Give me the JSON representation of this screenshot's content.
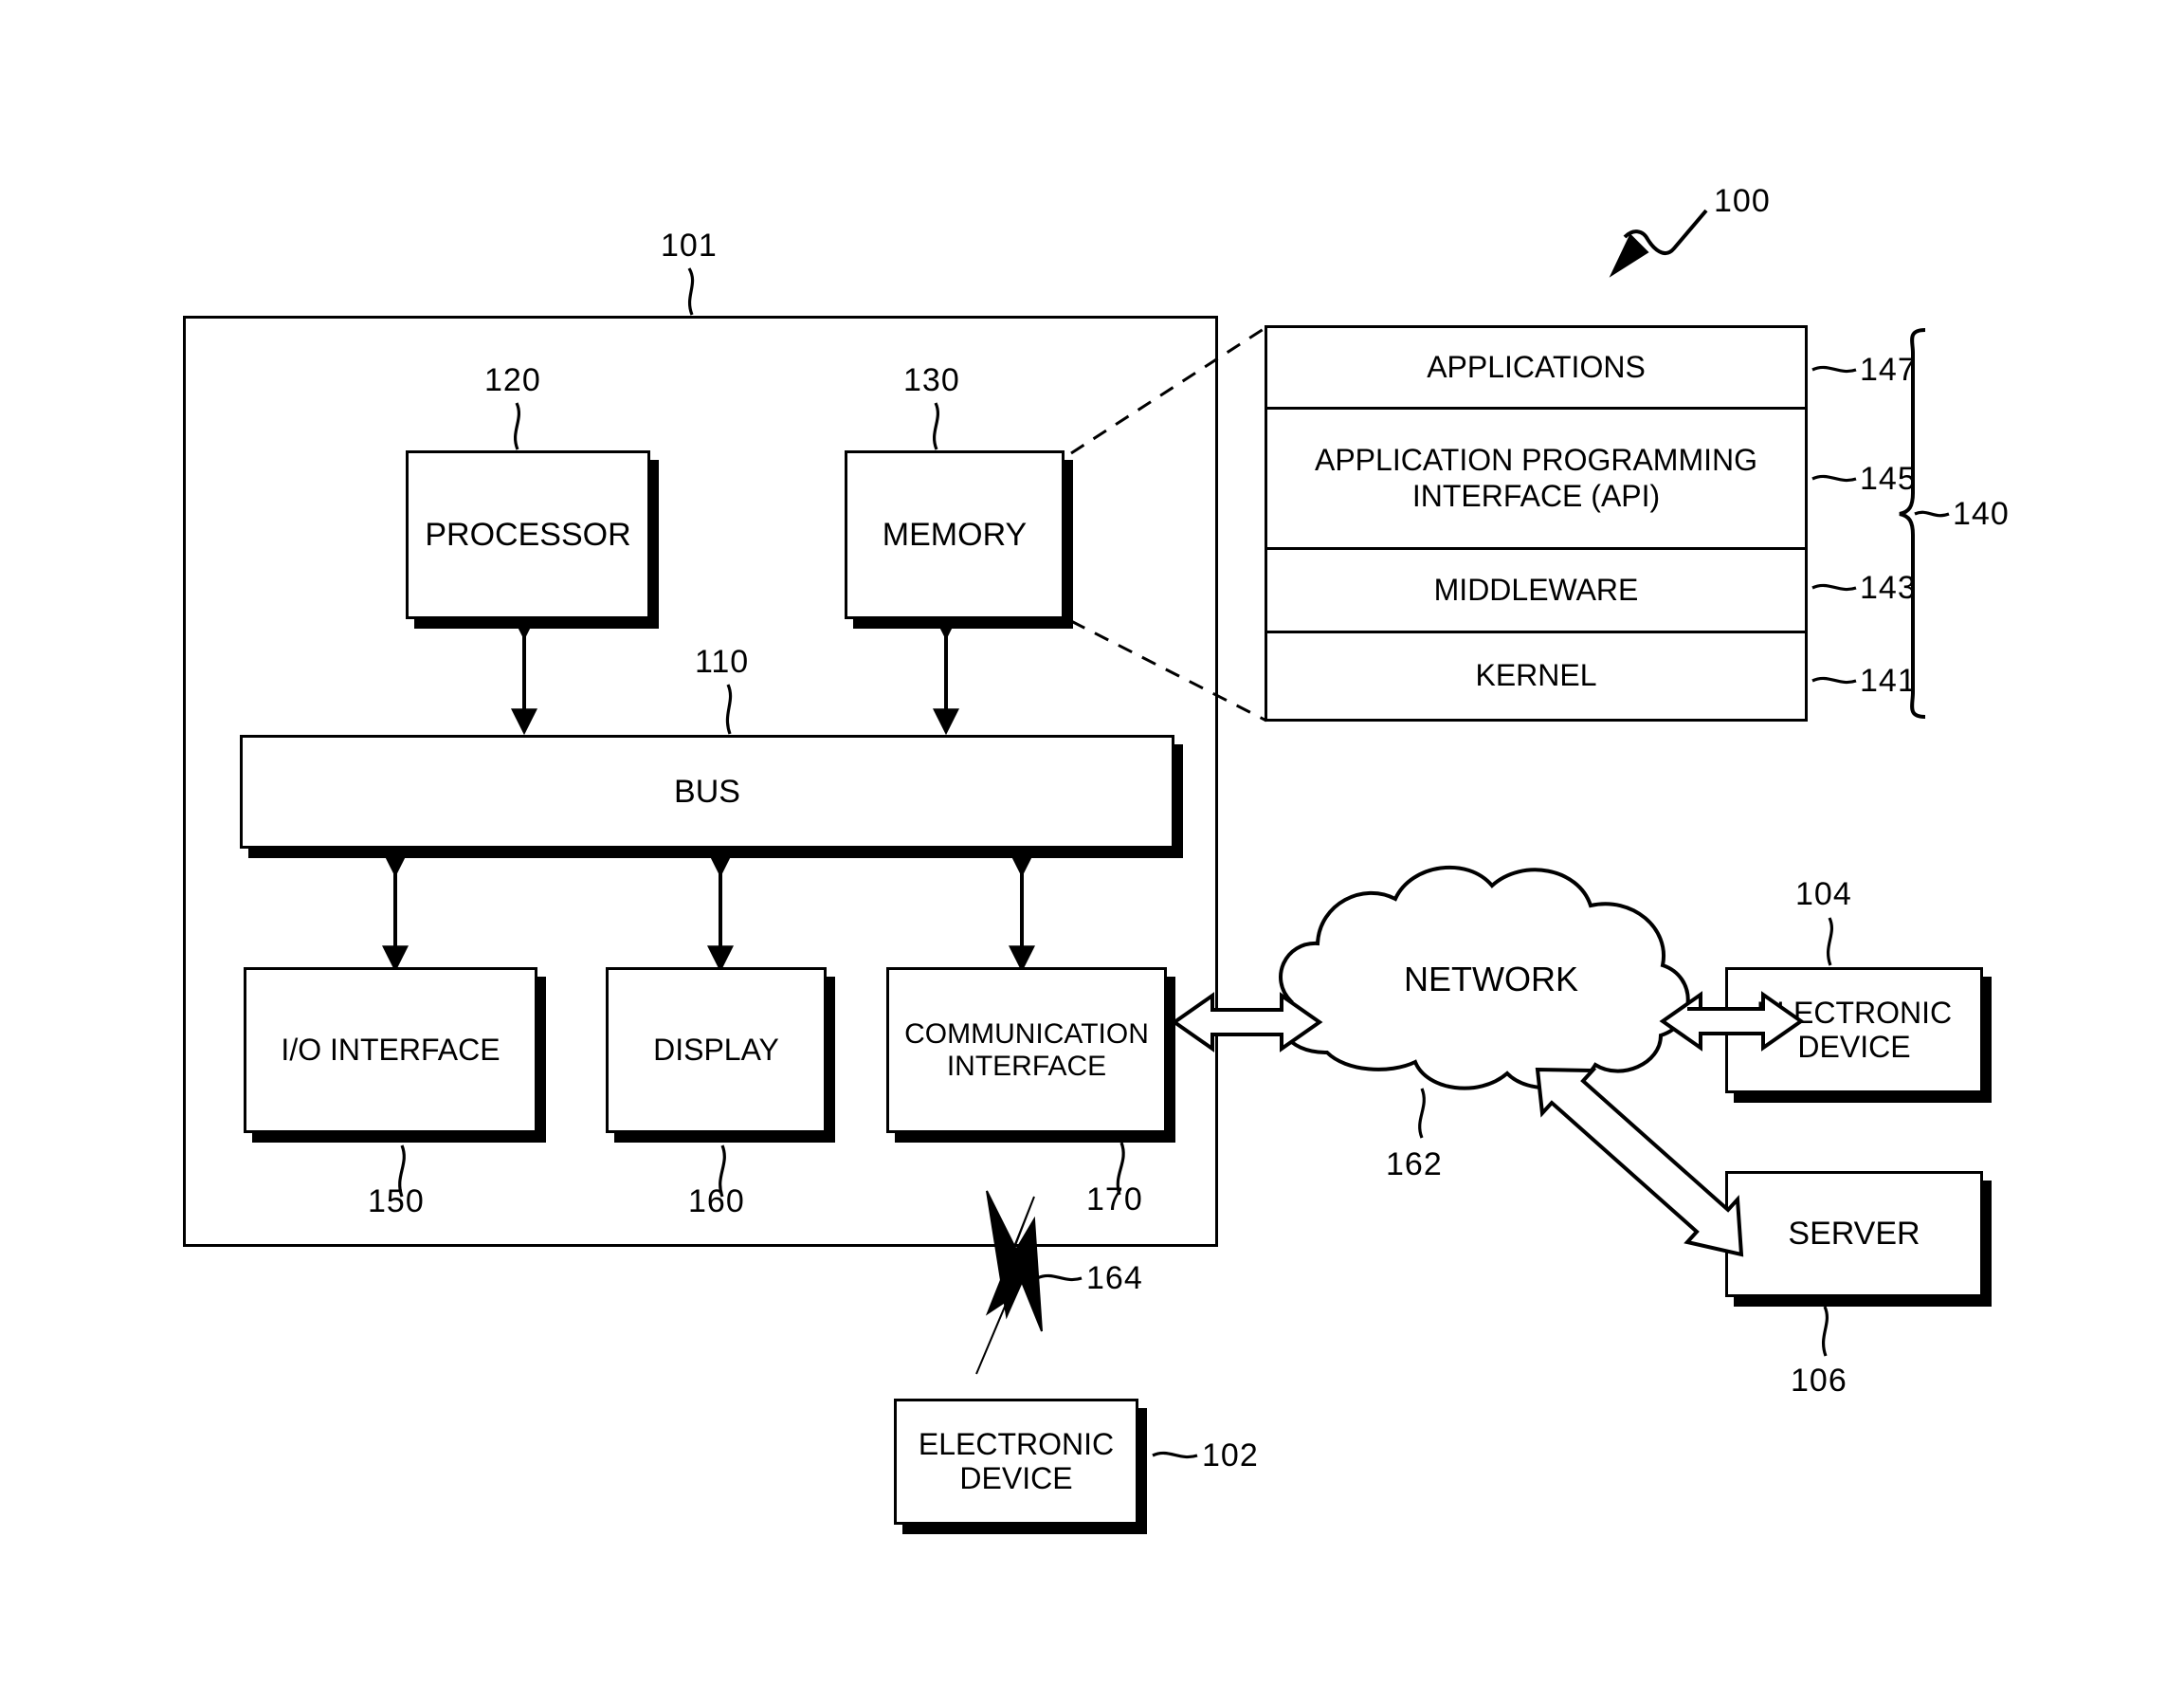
{
  "figure": {
    "system_ref": "100",
    "device_ref": "101"
  },
  "device_101": {
    "ref": "101",
    "bus": {
      "label": "BUS",
      "ref": "110"
    },
    "processor": {
      "label": "PROCESSOR",
      "ref": "120"
    },
    "memory": {
      "label": "MEMORY",
      "ref": "130"
    },
    "io_interface": {
      "label": "I/O INTERFACE",
      "ref": "150"
    },
    "display": {
      "label": "DISPLAY",
      "ref": "160"
    },
    "communication_interface": {
      "label": "COMMUNICATION\nINTERFACE",
      "line1": "COMMUNICATION",
      "line2": "INTERFACE",
      "ref": "170"
    }
  },
  "program_stack": {
    "ref": "140",
    "layers": [
      {
        "label": "APPLICATIONS",
        "ref": "147"
      },
      {
        "label": "APPLICATION PROGRAMMING INTERFACE (API)",
        "line1": "APPLICATION PROGRAMMING",
        "line2": "INTERFACE (API)",
        "ref": "145"
      },
      {
        "label": "MIDDLEWARE",
        "ref": "143"
      },
      {
        "label": "KERNEL",
        "ref": "141"
      }
    ]
  },
  "network": {
    "label": "NETWORK",
    "ref": "162"
  },
  "wireless_link": {
    "ref": "164"
  },
  "external_nodes": {
    "electronic_device_102": {
      "line1": "ELECTRONIC",
      "line2": "DEVICE",
      "ref": "102"
    },
    "electronic_device_104": {
      "line1": "ELECTRONIC",
      "line2": "DEVICE",
      "ref": "104"
    },
    "server_106": {
      "label": "SERVER",
      "ref": "106"
    }
  },
  "style": {
    "ink": "#000000",
    "paper": "#ffffff"
  }
}
